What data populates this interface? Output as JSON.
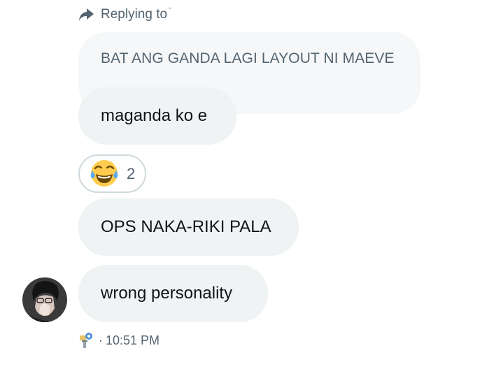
{
  "reply": {
    "label": "Replying to",
    "mark": "˚",
    "quoted_text": "BAT ANG GANDA LAGI LAYOUT NI MAEVE"
  },
  "messages": [
    {
      "text": "maganda ko e"
    },
    {
      "text": "OPS NAKA-RIKI PALA"
    },
    {
      "text": "wrong personality"
    }
  ],
  "reaction": {
    "emoji": "face-with-tears-of-joy-icon",
    "count": "2"
  },
  "meta": {
    "separator": "·",
    "time": "10:51 PM"
  },
  "colors": {
    "bubble": "#eff3f4",
    "quoted_bubble": "#f5f7f8",
    "secondary_text": "#536471",
    "primary_text": "#0f1419",
    "reaction_border": "#cfd9de"
  }
}
